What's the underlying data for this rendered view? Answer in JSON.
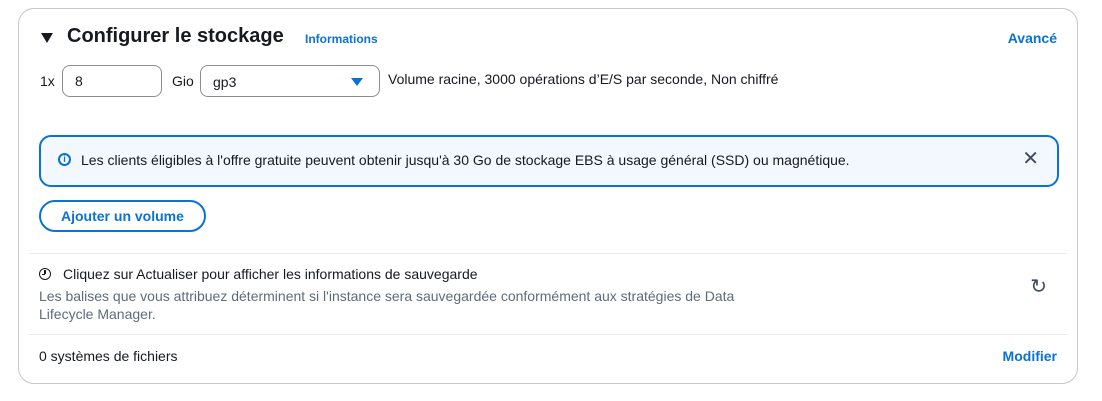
{
  "header": {
    "title": "Configurer le stockage",
    "info_link": "Informations",
    "advanced_link": "Avancé"
  },
  "volume": {
    "multiplier": "1x",
    "size_value": "8",
    "unit": "Gio",
    "type_selected": "gp3",
    "summary": "Volume racine,  3000 opérations d’E/S par seconde,  Non chiffré"
  },
  "alert": {
    "text": "Les clients éligibles à l'offre gratuite peuvent obtenir jusqu'à 30 Go de stockage EBS à usage général (SSD) ou magnétique."
  },
  "add_volume_button": "Ajouter un volume",
  "backup": {
    "heading": "Cliquez sur Actualiser pour afficher les informations de sauvegarde",
    "description": "Les balises que vous attribuez déterminent si l'instance sera sauvegardée conformément aux stratégies de Data Lifecycle Manager."
  },
  "file_systems": {
    "count_label": "0 systèmes de fichiers",
    "modify_link": "Modifier"
  },
  "icons": {
    "caret": "caret-down-icon",
    "select_arrow": "triangle-down-icon",
    "info": "info-circle-icon",
    "close": "close-icon",
    "clock": "clock-icon",
    "refresh": "refresh-icon"
  },
  "colors": {
    "accent": "#0972d3",
    "alert_bg": "#f2f8fd",
    "text": "#16191f",
    "muted": "#5f6b7a"
  }
}
